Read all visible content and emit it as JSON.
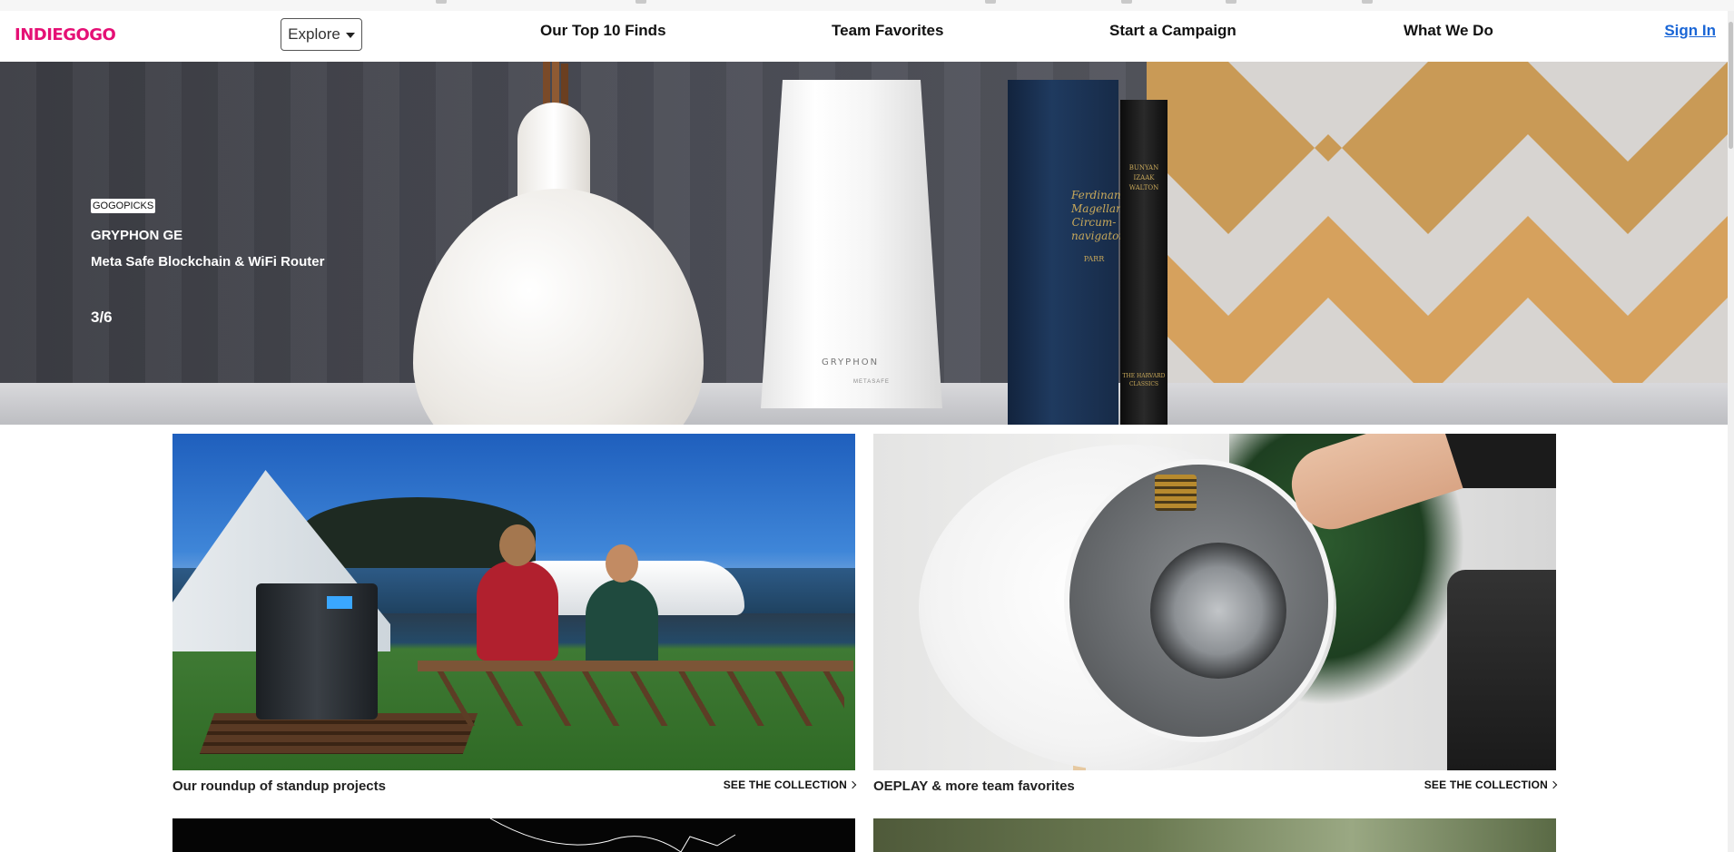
{
  "brand": {
    "logo": "INDIEGOGO",
    "accent": "#e51075",
    "link_color": "#1a66d6"
  },
  "nav": {
    "explore_label": "Explore",
    "links": [
      "Our Top 10 Finds",
      "Team Favorites",
      "Start a Campaign",
      "What We Do"
    ],
    "sign_in": "Sign In"
  },
  "hero": {
    "badge": "GOGOPICKS",
    "title": "GRYPHON GE",
    "subtitle": "Meta Safe Blockchain & WiFi Router",
    "counter": "3/6",
    "image_text": {
      "router_brand": "GRYPHON",
      "router_sub": "METASAFE",
      "book1": "Ferdinand Magellan, Circum-navigator",
      "book1_author": "PARR",
      "book2": "BUNYAN IZAAK WALTON",
      "book2_bottom": "THE HARVARD CLASSICS"
    }
  },
  "collections": [
    {
      "caption": "Our roundup of standup projects",
      "cta": "SEE THE COLLECTION"
    },
    {
      "caption": "OEPLAY & more team favorites",
      "cta": "SEE THE COLLECTION"
    }
  ]
}
